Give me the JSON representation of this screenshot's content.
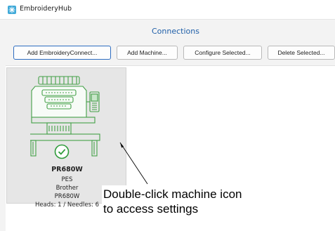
{
  "app": {
    "title": "EmbroideryHub",
    "icon": "embroidery-app-icon",
    "accent": "#1f5fa8"
  },
  "section": {
    "title": "Connections"
  },
  "toolbar": {
    "add_connect_label": "Add EmbroideryConnect...",
    "add_machine_label": "Add Machine...",
    "configure_label": "Configure Selected...",
    "delete_label": "Delete Selected..."
  },
  "machine": {
    "name": "PR680W",
    "format": "PES",
    "brand": "Brother",
    "model": "PR680W",
    "heads_needles": "Heads: 1 / Needles: 6",
    "status_icon": "check-circle-icon",
    "status_color": "#2e9b3a"
  },
  "annotation": {
    "line1": "Double-click machine icon",
    "line2": "to access settings"
  }
}
